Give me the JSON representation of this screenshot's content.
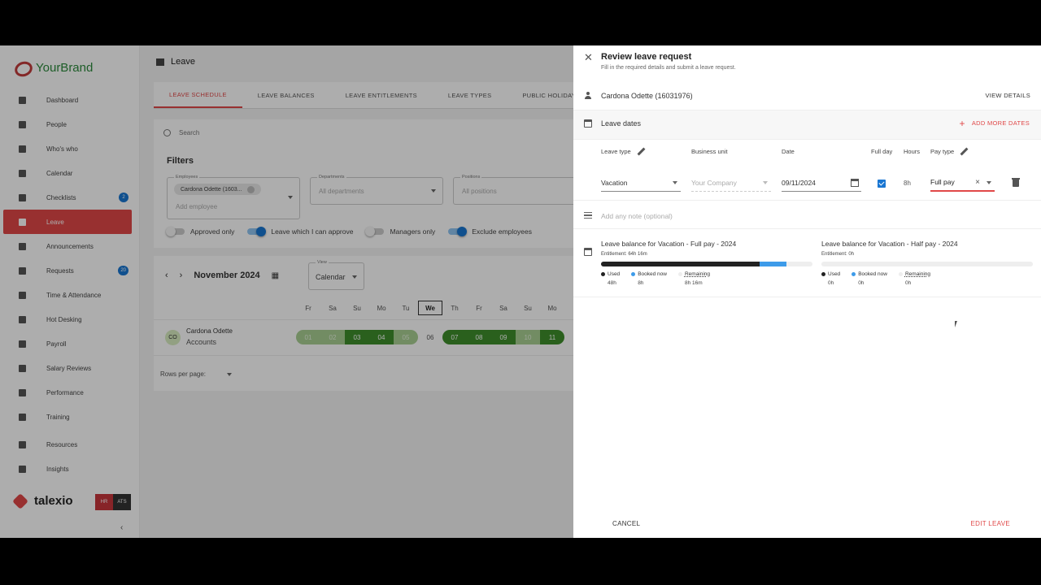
{
  "brand": {
    "name": "YourBrand"
  },
  "sidebar": {
    "items": [
      {
        "label": "Dashboard",
        "icon": "dashboard-icon"
      },
      {
        "label": "People",
        "icon": "people-icon"
      },
      {
        "label": "Who's who",
        "icon": "contact-icon"
      },
      {
        "label": "Calendar",
        "icon": "calendar-icon"
      },
      {
        "label": "Checklists",
        "icon": "checklist-icon",
        "badge": "2"
      },
      {
        "label": "Leave",
        "icon": "leave-icon",
        "active": true
      },
      {
        "label": "Announcements",
        "icon": "announcement-icon"
      },
      {
        "label": "Requests",
        "icon": "requests-icon",
        "badge": "20"
      },
      {
        "label": "Time & Attendance",
        "icon": "time-icon"
      },
      {
        "label": "Hot Desking",
        "icon": "desk-icon"
      },
      {
        "label": "Payroll",
        "icon": "euro-icon"
      },
      {
        "label": "Salary Reviews",
        "icon": "salary-icon"
      },
      {
        "label": "Performance",
        "icon": "performance-icon"
      },
      {
        "label": "Training",
        "icon": "training-icon"
      },
      {
        "label": "Resources",
        "icon": "folder-icon"
      },
      {
        "label": "Insights",
        "icon": "insights-icon"
      }
    ],
    "footer_brand": "talexio",
    "hr": "HR",
    "ats": "ATS",
    "collapse": "‹"
  },
  "main": {
    "title": "Leave",
    "tabs": [
      "LEAVE SCHEDULE",
      "LEAVE BALANCES",
      "LEAVE ENTITLEMENTS",
      "LEAVE TYPES",
      "PUBLIC HOLIDAYS"
    ],
    "search_placeholder": "Search",
    "filters": {
      "title": "Filters",
      "employees_label": "Employees",
      "employee_chip": "Cardona Odette (1603...",
      "add_employee": "Add employee",
      "departments_label": "Departments",
      "departments_value": "All departments",
      "positions_label": "Positions",
      "positions_value": "All positions",
      "toggles": [
        "Approved only",
        "Leave which I can approve",
        "Managers only",
        "Exclude employees"
      ]
    },
    "calendar": {
      "month": "November 2024",
      "view_label": "View",
      "view_value": "Calendar",
      "days": [
        "Fr",
        "Sa",
        "Su",
        "Mo",
        "Tu",
        "We",
        "Th",
        "Fr",
        "Sa",
        "Su",
        "Mo"
      ],
      "employee_initials": "CO",
      "employee_name": "Cardona Odette",
      "employee_dept": "Accounts",
      "dates": [
        "01",
        "02",
        "03",
        "04",
        "05",
        "06",
        "07",
        "08",
        "09",
        "10",
        "11"
      ],
      "rows_per_page": "Rows per page:"
    }
  },
  "panel": {
    "title": "Review leave request",
    "subtitle": "Fill in the required details and submit a leave request.",
    "person": "Cardona Odette (16031976)",
    "view_details": "VIEW DETAILS",
    "leave_dates": "Leave dates",
    "add_more_dates": "ADD MORE DATES",
    "columns": {
      "leave_type": "Leave type",
      "business_unit": "Business unit",
      "date": "Date",
      "full_day": "Full day",
      "hours": "Hours",
      "pay_type": "Pay type"
    },
    "row": {
      "leave_type": "Vacation",
      "business_unit": "Your Company",
      "date": "09/11/2024",
      "hours": "8h",
      "pay_type": "Full pay"
    },
    "note_placeholder": "Add any note (optional)",
    "balances": [
      {
        "title": "Leave balance for Vacation - Full pay - 2024",
        "entitlement": "Entitlement: 64h 16m",
        "used": "48h",
        "booked": "8h",
        "remaining": "8h 16m",
        "used_frac": 0.75,
        "booked_frac": 0.125
      },
      {
        "title": "Leave balance for Vacation - Half pay - 2024",
        "entitlement": "Entitlement: 0h",
        "used": "0h",
        "booked": "0h",
        "remaining": "0h",
        "used_frac": 0,
        "booked_frac": 0
      }
    ],
    "legend": {
      "used": "Used",
      "booked": "Booked now",
      "remaining": "Remaining"
    },
    "cancel": "CANCEL",
    "edit": "EDIT LEAVE"
  },
  "colors": {
    "accent": "#e04848",
    "primary": "#1976d2",
    "leave_green": "#3e8e2c"
  }
}
